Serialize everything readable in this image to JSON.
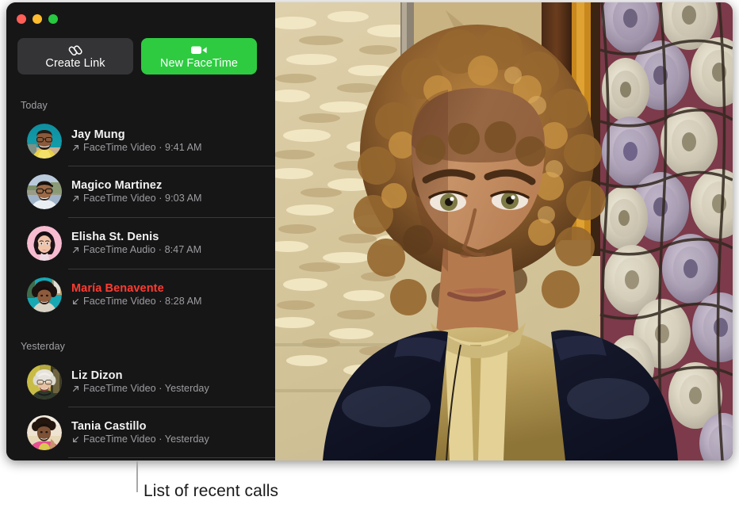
{
  "window": {
    "traffic_lights": [
      {
        "name": "close",
        "color": "#ff5f57"
      },
      {
        "name": "minimize",
        "color": "#febc2e"
      },
      {
        "name": "zoom",
        "color": "#28c840"
      }
    ]
  },
  "toolbar": {
    "create_link_label": "Create Link",
    "create_link_icon": "link-icon",
    "new_facetime_label": "New FaceTime",
    "new_facetime_icon": "video-camera-icon",
    "new_facetime_color": "#2ecb41",
    "create_link_color": "#343436"
  },
  "sections": [
    {
      "title": "Today"
    },
    {
      "title": "Yesterday"
    }
  ],
  "calls": [
    {
      "name": "Jay Mung",
      "detail": "FaceTime Video · 9:41 AM",
      "direction": "outgoing",
      "missed": false,
      "avatar": "jay-mung-avatar"
    },
    {
      "name": "Magico Martinez",
      "detail": "FaceTime Video · 9:03 AM",
      "direction": "outgoing",
      "missed": false,
      "avatar": "magico-martinez-avatar"
    },
    {
      "name": "Elisha St. Denis",
      "detail": "FaceTime Audio · 8:47 AM",
      "direction": "outgoing",
      "missed": false,
      "avatar": "elisha-st-denis-avatar"
    },
    {
      "name": "María Benavente",
      "detail": "FaceTime Video · 8:28 AM",
      "direction": "incoming",
      "missed": true,
      "avatar": "maria-benavente-avatar"
    },
    {
      "name": "Liz Dizon",
      "detail": "FaceTime Video · Yesterday",
      "direction": "outgoing",
      "missed": false,
      "avatar": "liz-dizon-avatar"
    },
    {
      "name": "Tania Castillo",
      "detail": "FaceTime Video · Yesterday",
      "direction": "incoming",
      "missed": false,
      "avatar": "tania-castillo-avatar"
    }
  ],
  "photo": {
    "description": "Person with curly hair in a navy jacket during a FaceTime call"
  },
  "callout": {
    "text": "List of recent calls"
  },
  "colors": {
    "missed_call": "#ff3b30",
    "sidebar_bg": "#161617",
    "accent_green": "#2ecb41"
  }
}
